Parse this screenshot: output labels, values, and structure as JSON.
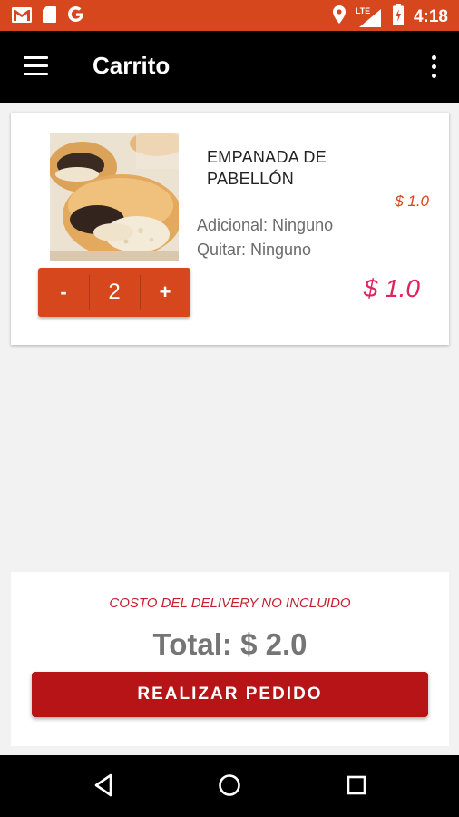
{
  "status_bar": {
    "time": "4:18",
    "network_label": "LTE",
    "left_icons": [
      "gmail-icon",
      "sd-card-icon",
      "google-icon"
    ],
    "right_icons": [
      "location-icon",
      "signal-icon",
      "battery-icon"
    ]
  },
  "toolbar": {
    "title": "Carrito",
    "menu_icon": "hamburger-menu-icon",
    "overflow_icon": "more-vertical-icon"
  },
  "cart": {
    "items": [
      {
        "name": "EMPANADA DE PABELLÓN",
        "unit_price": "$ 1.0",
        "additional": "Adicional: Ninguno",
        "remove": "Quitar: Ninguno",
        "minus_label": "-",
        "quantity": "2",
        "plus_label": "+",
        "line_total": "$ 1.0"
      }
    ]
  },
  "summary": {
    "delivery_note": "COSTO DEL DELIVERY NO INCLUIDO",
    "total": "Total: $ 2.0",
    "order_button": "REALIZAR PEDIDO"
  },
  "colors": {
    "status_bar": "#d6471d",
    "accent": "#d6471d",
    "price_pink": "#e0245e",
    "order_button": "#b71417"
  }
}
